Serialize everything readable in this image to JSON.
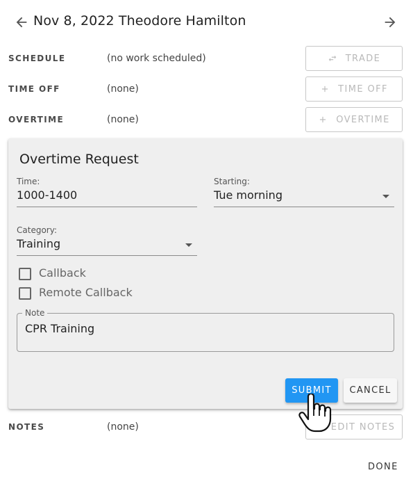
{
  "header": {
    "title": "Nov 8, 2022 Theodore Hamilton",
    "back_icon": "arrow-left-icon",
    "forward_icon": "arrow-right-icon"
  },
  "rows": {
    "schedule": {
      "label": "SCHEDULE",
      "value": "(no work scheduled)",
      "button": "TRADE",
      "button_icon": "swap-icon"
    },
    "time_off": {
      "label": "TIME OFF",
      "value": "(none)",
      "button": "TIME OFF",
      "button_icon": "plus-icon"
    },
    "overtime": {
      "label": "OVERTIME",
      "value": "(none)",
      "button": "OVERTIME",
      "button_icon": "plus-icon"
    },
    "notes": {
      "label": "NOTES",
      "value": "(none)",
      "button": "EDIT NOTES",
      "button_icon": "edit-icon"
    }
  },
  "overtime_request": {
    "title": "Overtime Request",
    "time": {
      "label": "Time:",
      "value": "1000-1400"
    },
    "starting": {
      "label": "Starting:",
      "value": "Tue morning"
    },
    "category": {
      "label": "Category:",
      "value": "Training"
    },
    "callback": {
      "label": "Callback",
      "checked": false
    },
    "remote_callback": {
      "label": "Remote Callback",
      "checked": false
    },
    "note": {
      "label": "Note",
      "value": "CPR Training"
    },
    "submit_label": "SUBMIT",
    "cancel_label": "CANCEL"
  },
  "footer": {
    "done_label": "DONE"
  },
  "colors": {
    "primary": "#2196f3",
    "card_bg": "#efefef",
    "disabled_text": "#b9b9b9"
  }
}
